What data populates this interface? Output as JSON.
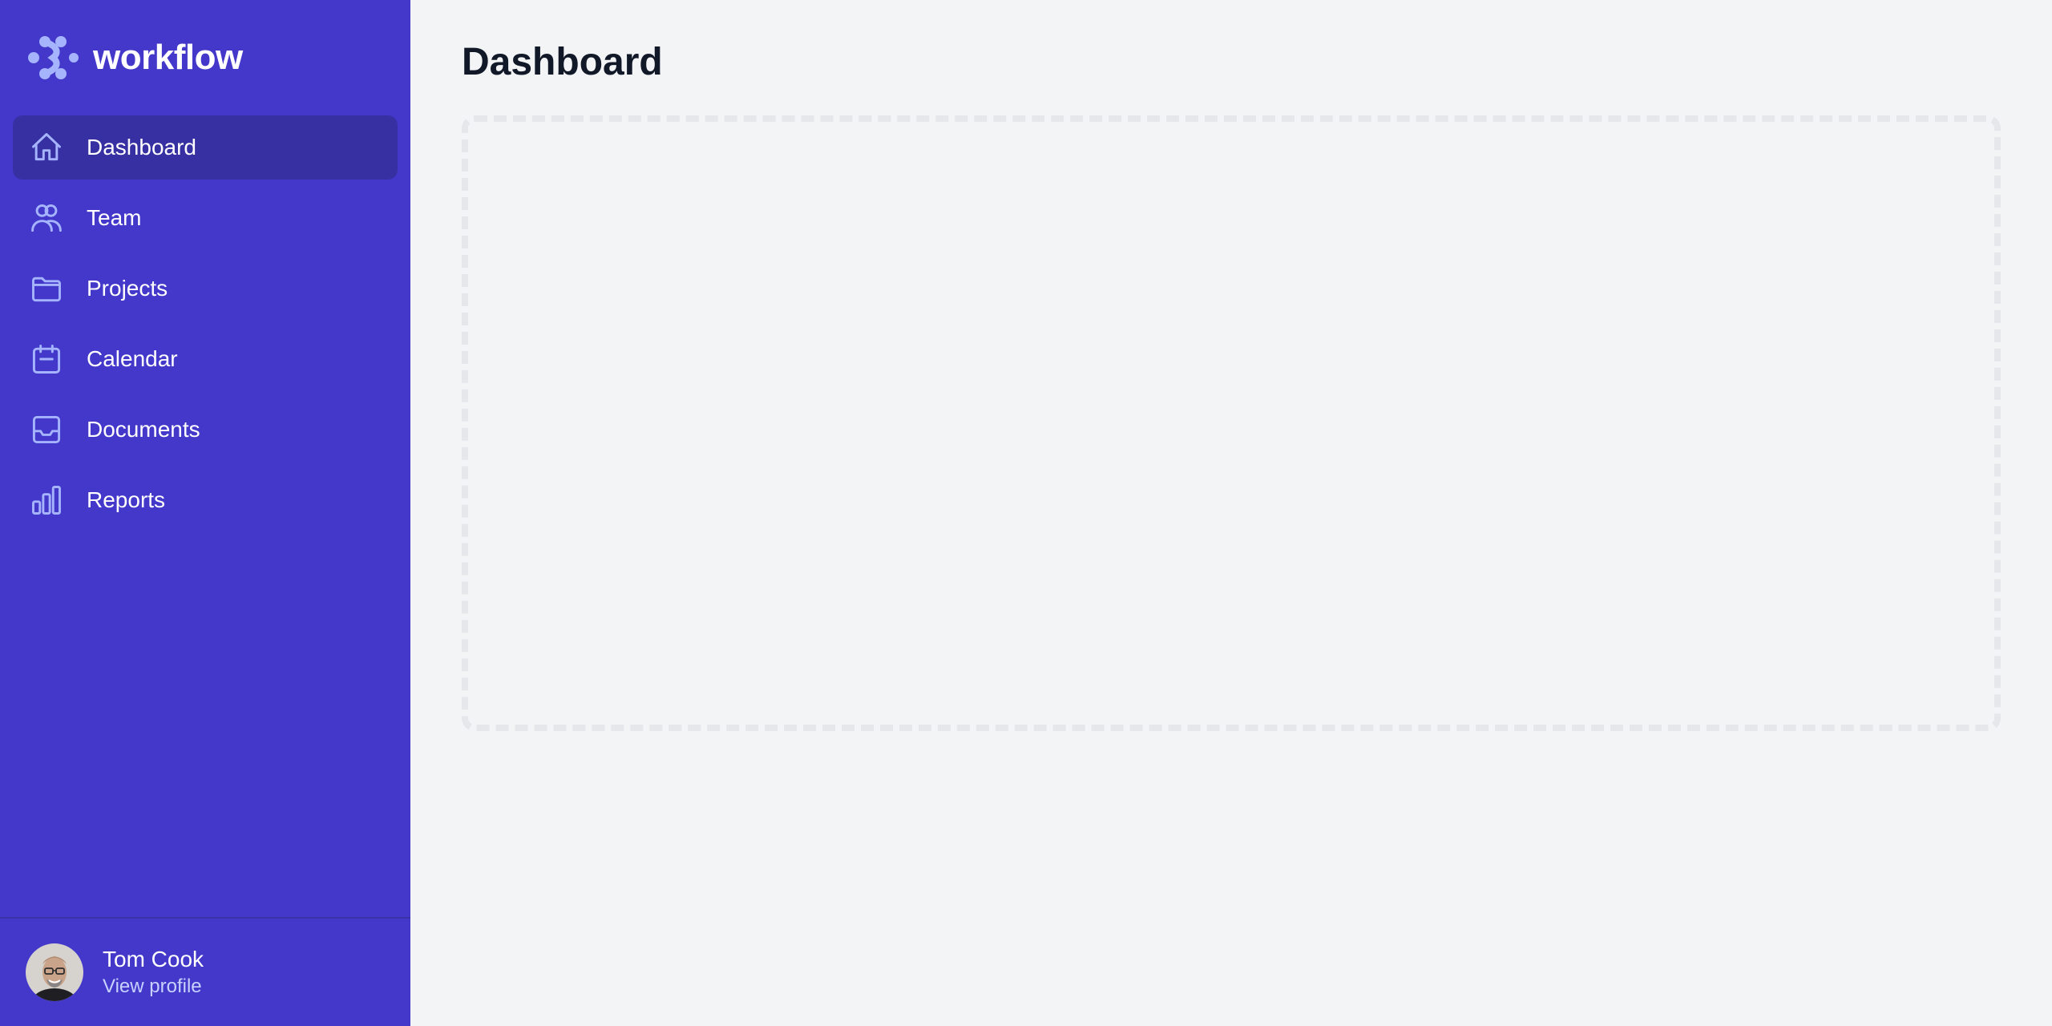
{
  "brand": {
    "name": "workflow",
    "icon": "workflow-logo"
  },
  "colors": {
    "sidebar_bg": "#4338ca",
    "sidebar_active": "#3730a3",
    "icon_color": "#a5b4fc",
    "main_bg": "#f3f4f6"
  },
  "nav": [
    {
      "label": "Dashboard",
      "icon": "home-icon",
      "active": true
    },
    {
      "label": "Team",
      "icon": "users-icon",
      "active": false
    },
    {
      "label": "Projects",
      "icon": "folder-icon",
      "active": false
    },
    {
      "label": "Calendar",
      "icon": "calendar-icon",
      "active": false
    },
    {
      "label": "Documents",
      "icon": "inbox-icon",
      "active": false
    },
    {
      "label": "Reports",
      "icon": "chart-bar-icon",
      "active": false
    }
  ],
  "user": {
    "name": "Tom Cook",
    "link": "View profile"
  },
  "main": {
    "title": "Dashboard"
  }
}
